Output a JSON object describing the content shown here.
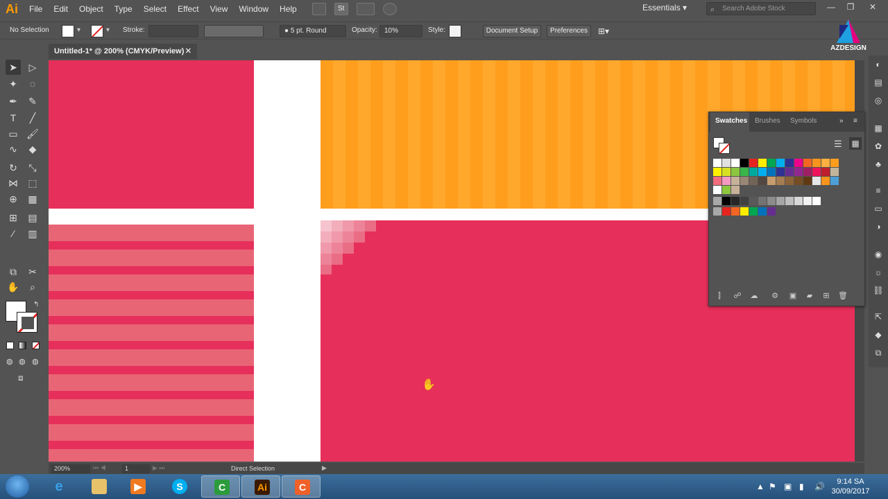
{
  "app": {
    "logo": "Ai"
  },
  "menu": [
    "File",
    "Edit",
    "Object",
    "Type",
    "Select",
    "Effect",
    "View",
    "Window",
    "Help"
  ],
  "menu_icons": [
    "br-icon",
    "st-icon",
    "arrange-icon",
    "gpu-icon"
  ],
  "workspace": {
    "label": "Essentials",
    "chevron": "▾"
  },
  "stock_search": {
    "placeholder": "Search Adobe Stock"
  },
  "window_controls": [
    "—",
    "❐",
    "✕"
  ],
  "control_bar": {
    "selection": "No Selection",
    "stroke_label": "Stroke:",
    "brush": "5 pt. Round",
    "opacity_label": "Opacity:",
    "opacity_value": "10%",
    "style_label": "Style:",
    "document_setup": "Document Setup",
    "preferences": "Preferences"
  },
  "document_tab": {
    "title": "Untitled-1* @ 200% (CMYK/Preview)",
    "close": "✕"
  },
  "status": {
    "zoom": "200%",
    "page": "1",
    "tool": "Direct Selection"
  },
  "swatches_panel": {
    "tabs": [
      "Swatches",
      "Brushes",
      "Symbols"
    ],
    "menu": "»"
  },
  "watermark": {
    "name": "AZDESIGN"
  },
  "taskbar": {
    "time": "9:14 SA",
    "date": "30/09/2017"
  },
  "colors": {
    "pink": "#e62f5a",
    "light_pink": "#e86576",
    "orange": "#ff9e1d",
    "ui_bg": "#535353"
  }
}
